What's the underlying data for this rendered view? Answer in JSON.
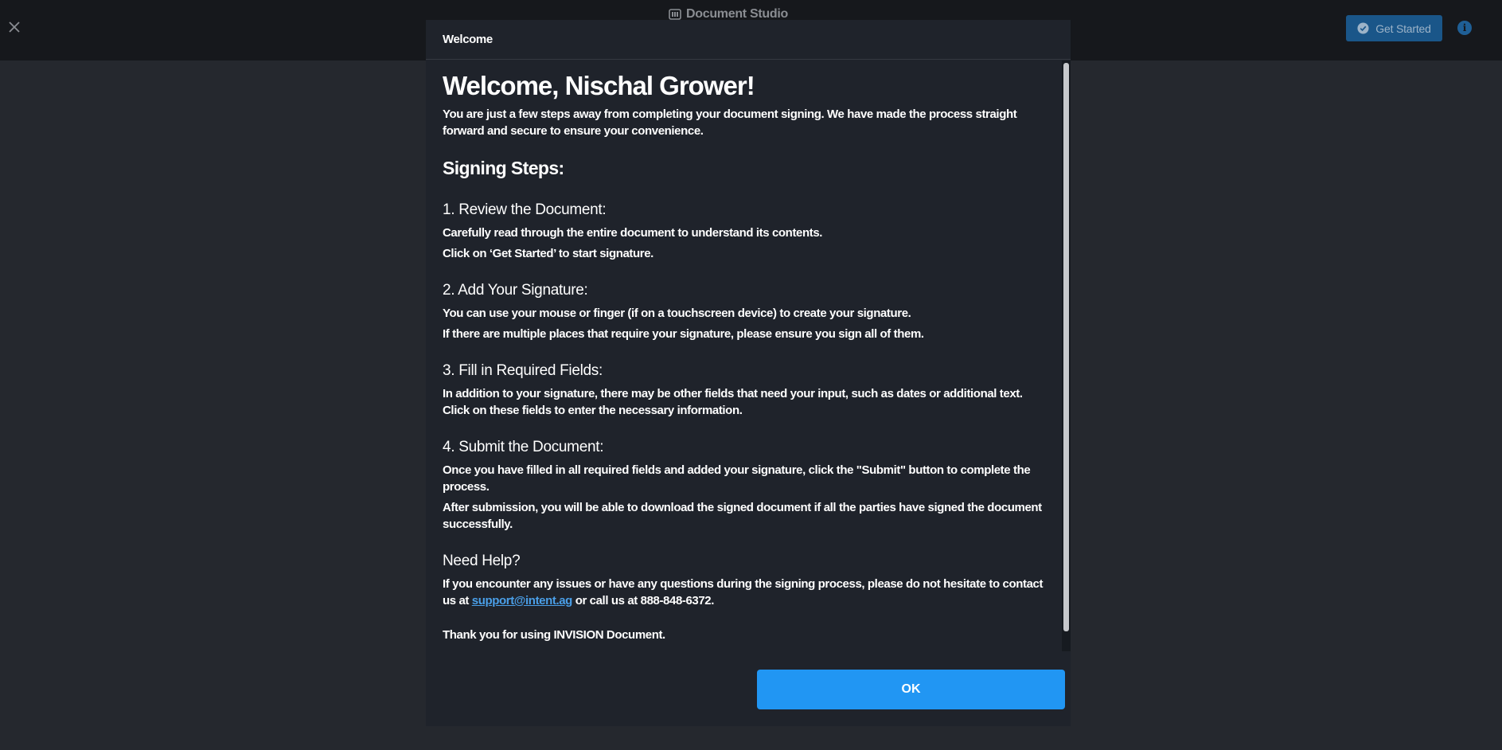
{
  "topbar": {
    "brand_title": "Document Studio",
    "get_started_label": "Get Started"
  },
  "modal": {
    "header_title": "Welcome",
    "greeting": "Welcome, Nischal Grower!",
    "intro": "You are just a few steps away from completing your document signing. We have made the process straight forward and secure to ensure your convenience.",
    "steps_title": "Signing Steps:",
    "steps": [
      {
        "title": "1. Review the Document:",
        "lines": [
          "Carefully read through the entire document to understand its contents.",
          "Click on ‘Get Started’ to start signature."
        ]
      },
      {
        "title": "2. Add Your Signature:",
        "lines": [
          "You can use your mouse or finger (if on a touchscreen device) to create your signature.",
          "If there are multiple places that require your signature, please ensure you sign all of them."
        ]
      },
      {
        "title": "3. Fill in Required Fields:",
        "lines": [
          "In addition to your signature, there may be other fields that need your input, such as dates or additional text. Click on these fields to enter the necessary information."
        ]
      },
      {
        "title": "4. Submit the Document:",
        "lines": [
          "Once you have filled in all required fields and added your signature, click the \"Submit\" button to complete the process.",
          "After submission, you will be able to download the signed document if all the parties have signed the document successfully."
        ]
      }
    ],
    "help": {
      "title": "Need Help?",
      "text_before": "If you encounter any issues or have any questions during the signing process, please do not hesitate to contact us at ",
      "email": "support@intent.ag",
      "text_after": " or call us at 888-848-6372."
    },
    "thanks": "Thank you for using INVISION Document.",
    "ok_label": "OK"
  },
  "colors": {
    "background": "#25282e",
    "topbar": "#16181c",
    "modal": "#1f232b",
    "accent": "#2196f3",
    "link": "#4a9fe8"
  }
}
